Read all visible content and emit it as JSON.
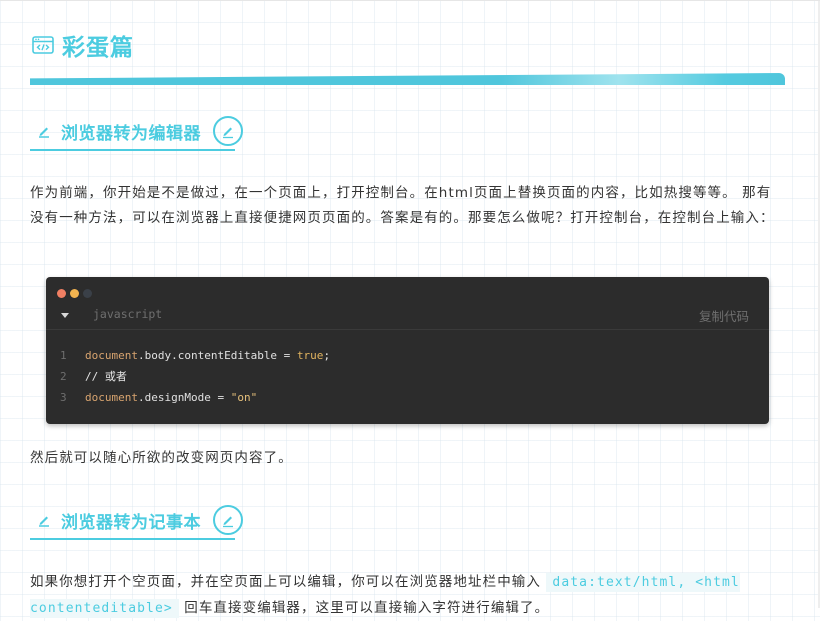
{
  "section_heading": "彩蛋篇",
  "subsection1": {
    "title": "浏览器转为编辑器",
    "paragraph": "作为前端，你开始是不是做过，在一个页面上，打开控制台。在html页面上替换页面的内容，比如热搜等等。 那有没有一种方法，可以在浏览器上直接便捷网页页面的。答案是有的。那要怎么做呢？打开控制台，在控制台上输入：",
    "code_block": {
      "language": "javascript",
      "copy_label": "复制代码",
      "lines": [
        {
          "num": "1",
          "tokens": [
            {
              "text": "document",
              "cls": "tok-obj"
            },
            {
              "text": ".body.contentEditable = ",
              "cls": "tok-prop"
            },
            {
              "text": "true",
              "cls": "tok-kw"
            },
            {
              "text": ";",
              "cls": "tok-plain"
            }
          ]
        },
        {
          "num": "2",
          "tokens": [
            {
              "text": "// 或者",
              "cls": "tok-plain"
            }
          ]
        },
        {
          "num": "3",
          "tokens": [
            {
              "text": "document",
              "cls": "tok-obj"
            },
            {
              "text": ".designMode = ",
              "cls": "tok-prop"
            },
            {
              "text": "\"on\"",
              "cls": "tok-str"
            }
          ]
        }
      ]
    },
    "after_text": "然后就可以随心所欲的改变网页内容了。"
  },
  "subsection2": {
    "title": "浏览器转为记事本",
    "paragraph_start": "如果你想打开个空页面，并在空页面上可以编辑，你可以在浏览器地址栏中输入 ",
    "inline_code": "data:text/html, <html contenteditable>",
    "paragraph_end": " 回车直接变编辑器，这里可以直接输入字符进行编辑了。"
  },
  "colors": {
    "accent": "#4ccce0",
    "code_bg": "#2c2c2c",
    "dot_red": "#f07f63",
    "dot_yellow": "#f3b450",
    "dot_dark": "#3a4048"
  }
}
